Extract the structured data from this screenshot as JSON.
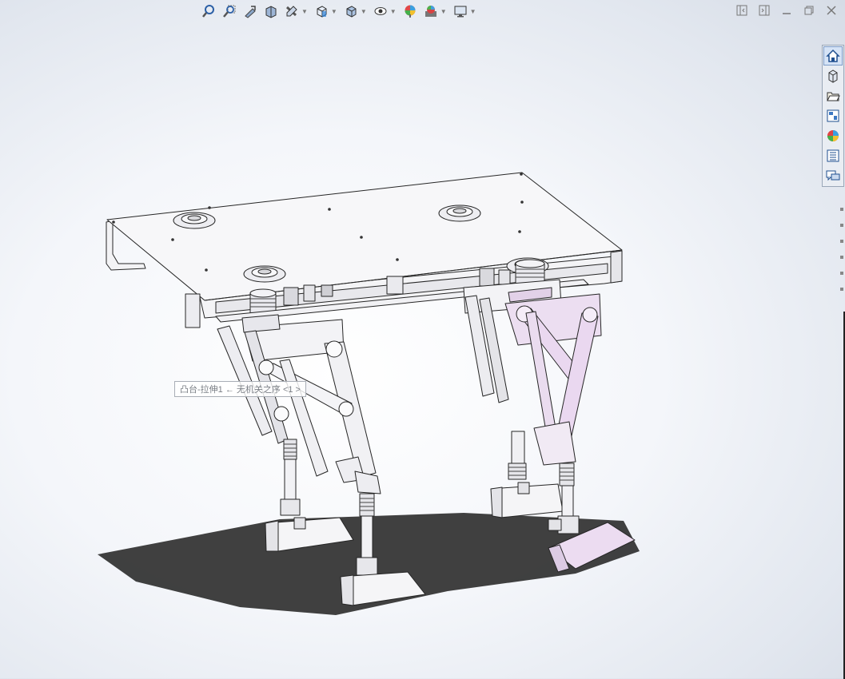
{
  "heads_up_toolbar": {
    "buttons": [
      {
        "name": "zoom-to-fit",
        "icon": "zoom-to-fit-icon",
        "dropdown": false
      },
      {
        "name": "zoom-to-area",
        "icon": "zoom-to-area-icon",
        "dropdown": false
      },
      {
        "name": "previous-view",
        "icon": "previous-view-icon",
        "dropdown": false
      },
      {
        "name": "section-view",
        "icon": "section-view-icon",
        "dropdown": false
      },
      {
        "name": "dynamic-annotation",
        "icon": "dynamic-annotation-icon",
        "dropdown": true
      },
      {
        "name": "view-orientation",
        "icon": "view-orientation-icon",
        "dropdown": true
      },
      {
        "name": "display-style",
        "icon": "display-style-icon",
        "dropdown": true
      },
      {
        "name": "hide-show-items",
        "icon": "hide-show-items-icon",
        "dropdown": true
      },
      {
        "name": "edit-appearance",
        "icon": "edit-appearance-icon",
        "dropdown": false
      },
      {
        "name": "apply-scene",
        "icon": "apply-scene-icon",
        "dropdown": true
      },
      {
        "name": "view-settings",
        "icon": "view-settings-icon",
        "dropdown": true
      }
    ]
  },
  "task_pane": {
    "tabs": [
      {
        "name": "resources",
        "icon": "home-icon"
      },
      {
        "name": "design-library",
        "icon": "design-library-icon"
      },
      {
        "name": "file-explorer",
        "icon": "folder-icon"
      },
      {
        "name": "view-palette",
        "icon": "view-palette-icon"
      },
      {
        "name": "appearances",
        "icon": "appearances-icon"
      },
      {
        "name": "custom-properties",
        "icon": "custom-properties-icon"
      },
      {
        "name": "forum",
        "icon": "forum-icon"
      }
    ]
  },
  "tooltip": {
    "text": "凸台-拉伸1 ← 无机关之序 <1 >"
  },
  "colors": {
    "part": "#f2f2f4",
    "edge": "#2a2a2a",
    "selected": "#e8d7ee",
    "shadow": "#2f2f2f"
  }
}
